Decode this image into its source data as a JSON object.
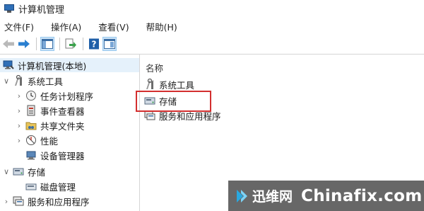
{
  "window": {
    "title": "计算机管理"
  },
  "menu": [
    {
      "label": "文件(F)"
    },
    {
      "label": "操作(A)"
    },
    {
      "label": "查看(V)"
    },
    {
      "label": "帮助(H)"
    }
  ],
  "toolbar": {
    "buttons": [
      "back-icon",
      "forward-icon",
      "show-hide-tree-icon",
      "export-list-icon",
      "help-icon",
      "properties-icon"
    ]
  },
  "tree": {
    "root": "计算机管理(本地)",
    "items": [
      {
        "label": "系统工具",
        "expanded": true
      },
      {
        "label": "任务计划程序"
      },
      {
        "label": "事件查看器"
      },
      {
        "label": "共享文件夹"
      },
      {
        "label": "性能"
      },
      {
        "label": "设备管理器"
      },
      {
        "label": "存储",
        "expanded": true
      },
      {
        "label": "磁盘管理"
      },
      {
        "label": "服务和应用程序"
      }
    ]
  },
  "list": {
    "header": "名称",
    "rows": [
      {
        "label": "系统工具"
      },
      {
        "label": "存储"
      },
      {
        "label": "服务和应用程序"
      }
    ]
  },
  "watermark": {
    "cn": "迅维网",
    "en": "Chinafix.com"
  },
  "colors": {
    "highlight_border": "#d32f2f",
    "selection": "#e5f1fb",
    "watermark_bg": "#464646"
  }
}
